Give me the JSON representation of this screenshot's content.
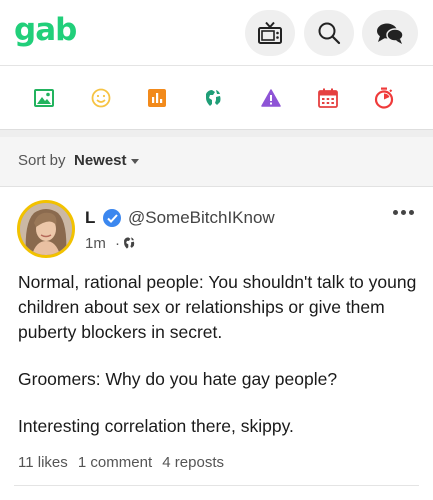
{
  "app": {
    "logo": "gab"
  },
  "header": {
    "buttons": [
      {
        "icon": "tv-icon"
      },
      {
        "icon": "search-icon"
      },
      {
        "icon": "chat-icon"
      }
    ]
  },
  "composer": {
    "icons": [
      {
        "name": "image-icon",
        "color": "#22b35e"
      },
      {
        "name": "smile-icon",
        "color": "#f6c343"
      },
      {
        "name": "chart-icon",
        "color": "#f28a1b"
      },
      {
        "name": "globe-icon",
        "color": "#1f9e77"
      },
      {
        "name": "warning-icon",
        "color": "#8e54d6"
      },
      {
        "name": "calendar-icon",
        "color": "#e54040"
      },
      {
        "name": "timer-icon",
        "color": "#ef3b3b"
      }
    ]
  },
  "sort": {
    "label": "Sort by",
    "value": "Newest"
  },
  "post": {
    "name": "L",
    "handle": "@SomeBitchIKnow",
    "time": "1m",
    "separator": "·",
    "paragraphs": [
      "Normal, rational people: You shouldn't talk to young children about sex or relationships or give them puberty blockers in secret.",
      "Groomers: Why do you hate gay people?",
      "Interesting correlation there, skippy."
    ],
    "stats": {
      "likes": "11 likes",
      "comments": "1 comment",
      "reposts": "4 reposts"
    }
  },
  "colors": {
    "brand": "#21cf7a",
    "verified": "#3b87ef",
    "avatar_ring": "#f2c200"
  }
}
